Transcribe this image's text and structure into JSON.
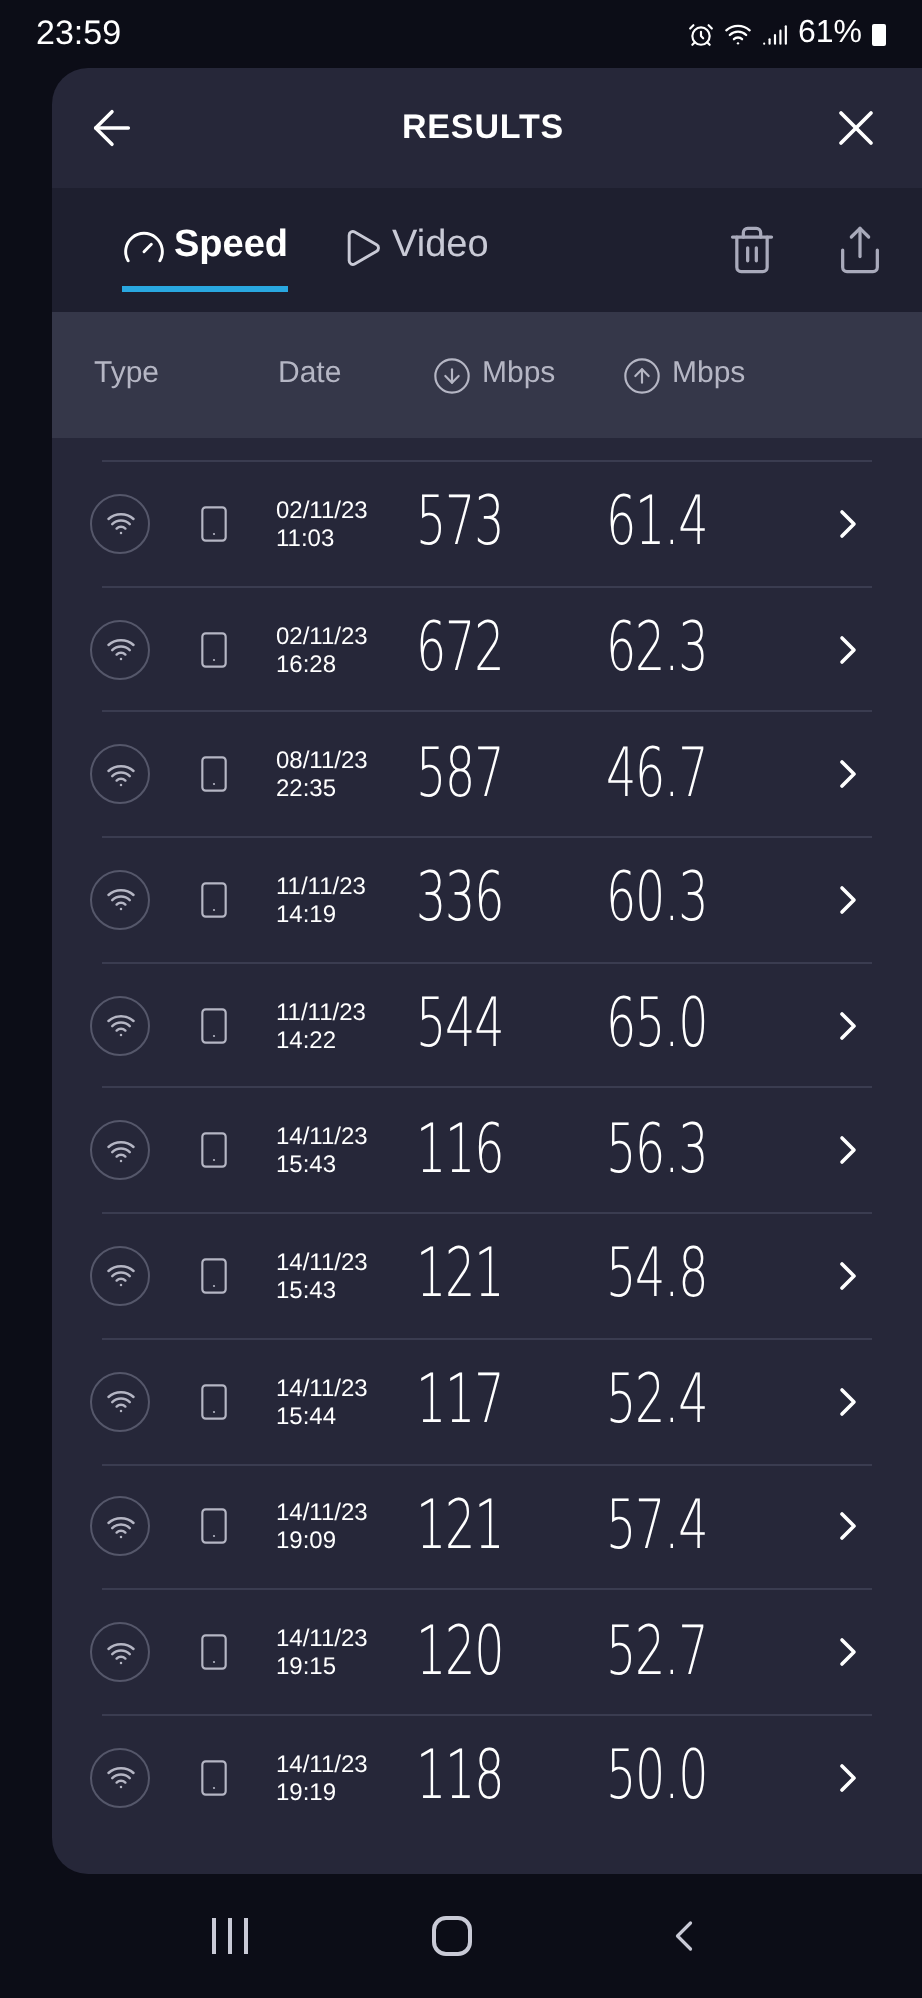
{
  "status_bar": {
    "time": "23:59",
    "battery": "61%"
  },
  "header": {
    "title": "RESULTS"
  },
  "tabs": [
    {
      "label": "Speed",
      "selected": true,
      "kind": "speed"
    },
    {
      "label": "Video",
      "selected": false,
      "kind": "video"
    }
  ],
  "table": {
    "columns": [
      "Type",
      "Date",
      "Mbps",
      "Mbps"
    ],
    "rows": [
      {
        "date": "02/11/23",
        "time": "11:03",
        "download": "573",
        "upload": "61.4"
      },
      {
        "date": "02/11/23",
        "time": "16:28",
        "download": "672",
        "upload": "62.3"
      },
      {
        "date": "08/11/23",
        "time": "22:35",
        "download": "587",
        "upload": "46.7"
      },
      {
        "date": "11/11/23",
        "time": "14:19",
        "download": "336",
        "upload": "60.3"
      },
      {
        "date": "11/11/23",
        "time": "14:22",
        "download": "544",
        "upload": "65.0"
      },
      {
        "date": "14/11/23",
        "time": "15:43",
        "download": "116",
        "upload": "56.3"
      },
      {
        "date": "14/11/23",
        "time": "15:43",
        "download": "121",
        "upload": "54.8"
      },
      {
        "date": "14/11/23",
        "time": "15:44",
        "download": "117",
        "upload": "52.4"
      },
      {
        "date": "14/11/23",
        "time": "19:09",
        "download": "121",
        "upload": "57.4"
      },
      {
        "date": "14/11/23",
        "time": "19:15",
        "download": "120",
        "upload": "52.7"
      },
      {
        "date": "14/11/23",
        "time": "19:19",
        "download": "118",
        "upload": "50.0"
      }
    ]
  }
}
